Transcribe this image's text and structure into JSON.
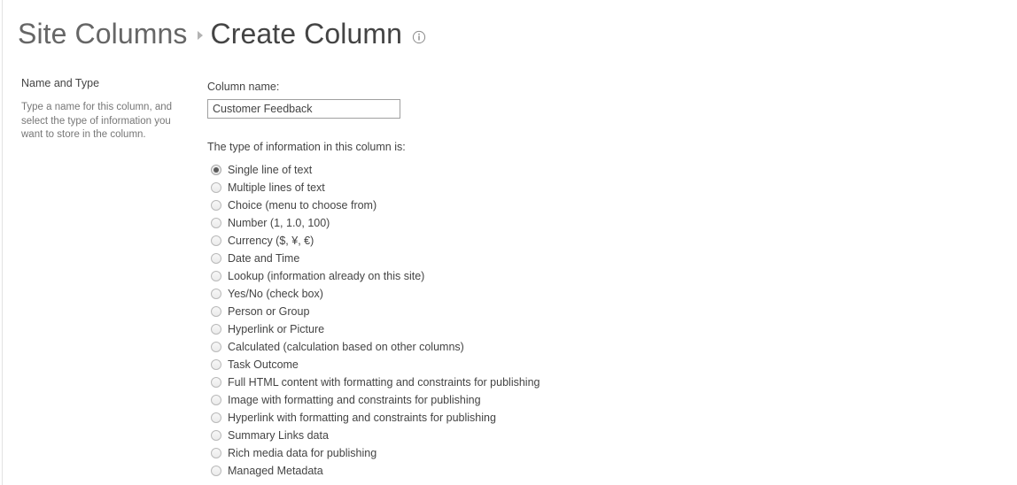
{
  "breadcrumb": {
    "parent": "Site Columns",
    "separator_icon": "caret-right-icon",
    "current": "Create Column",
    "info_icon": "info-icon"
  },
  "sidebar": {
    "heading": "Name and Type",
    "description": "Type a name for this column, and select the type of information you want to store in the column."
  },
  "form": {
    "column_name_label": "Column name:",
    "column_name_value": "Customer Feedback",
    "column_name_placeholder": "",
    "type_label": "The type of information in this column is:",
    "selected_type": "Single line of text",
    "types": [
      {
        "label": "Single line of text",
        "checked": true
      },
      {
        "label": "Multiple lines of text",
        "checked": false
      },
      {
        "label": "Choice (menu to choose from)",
        "checked": false
      },
      {
        "label": "Number (1, 1.0, 100)",
        "checked": false
      },
      {
        "label": "Currency ($, ¥, €)",
        "checked": false
      },
      {
        "label": "Date and Time",
        "checked": false
      },
      {
        "label": "Lookup (information already on this site)",
        "checked": false
      },
      {
        "label": "Yes/No (check box)",
        "checked": false
      },
      {
        "label": "Person or Group",
        "checked": false
      },
      {
        "label": "Hyperlink or Picture",
        "checked": false
      },
      {
        "label": "Calculated (calculation based on other columns)",
        "checked": false
      },
      {
        "label": "Task Outcome",
        "checked": false
      },
      {
        "label": "Full HTML content with formatting and constraints for publishing",
        "checked": false
      },
      {
        "label": "Image with formatting and constraints for publishing",
        "checked": false
      },
      {
        "label": "Hyperlink with formatting and constraints for publishing",
        "checked": false
      },
      {
        "label": "Summary Links data",
        "checked": false
      },
      {
        "label": "Rich media data for publishing",
        "checked": false
      },
      {
        "label": "Managed Metadata",
        "checked": false
      }
    ]
  },
  "colors": {
    "text": "#444444",
    "muted_text": "#777777",
    "crumb_link": "#666666",
    "input_border": "#a0a0a0",
    "radio_dot": "#5b5b5b",
    "page_edge": "#e3e3e3"
  }
}
